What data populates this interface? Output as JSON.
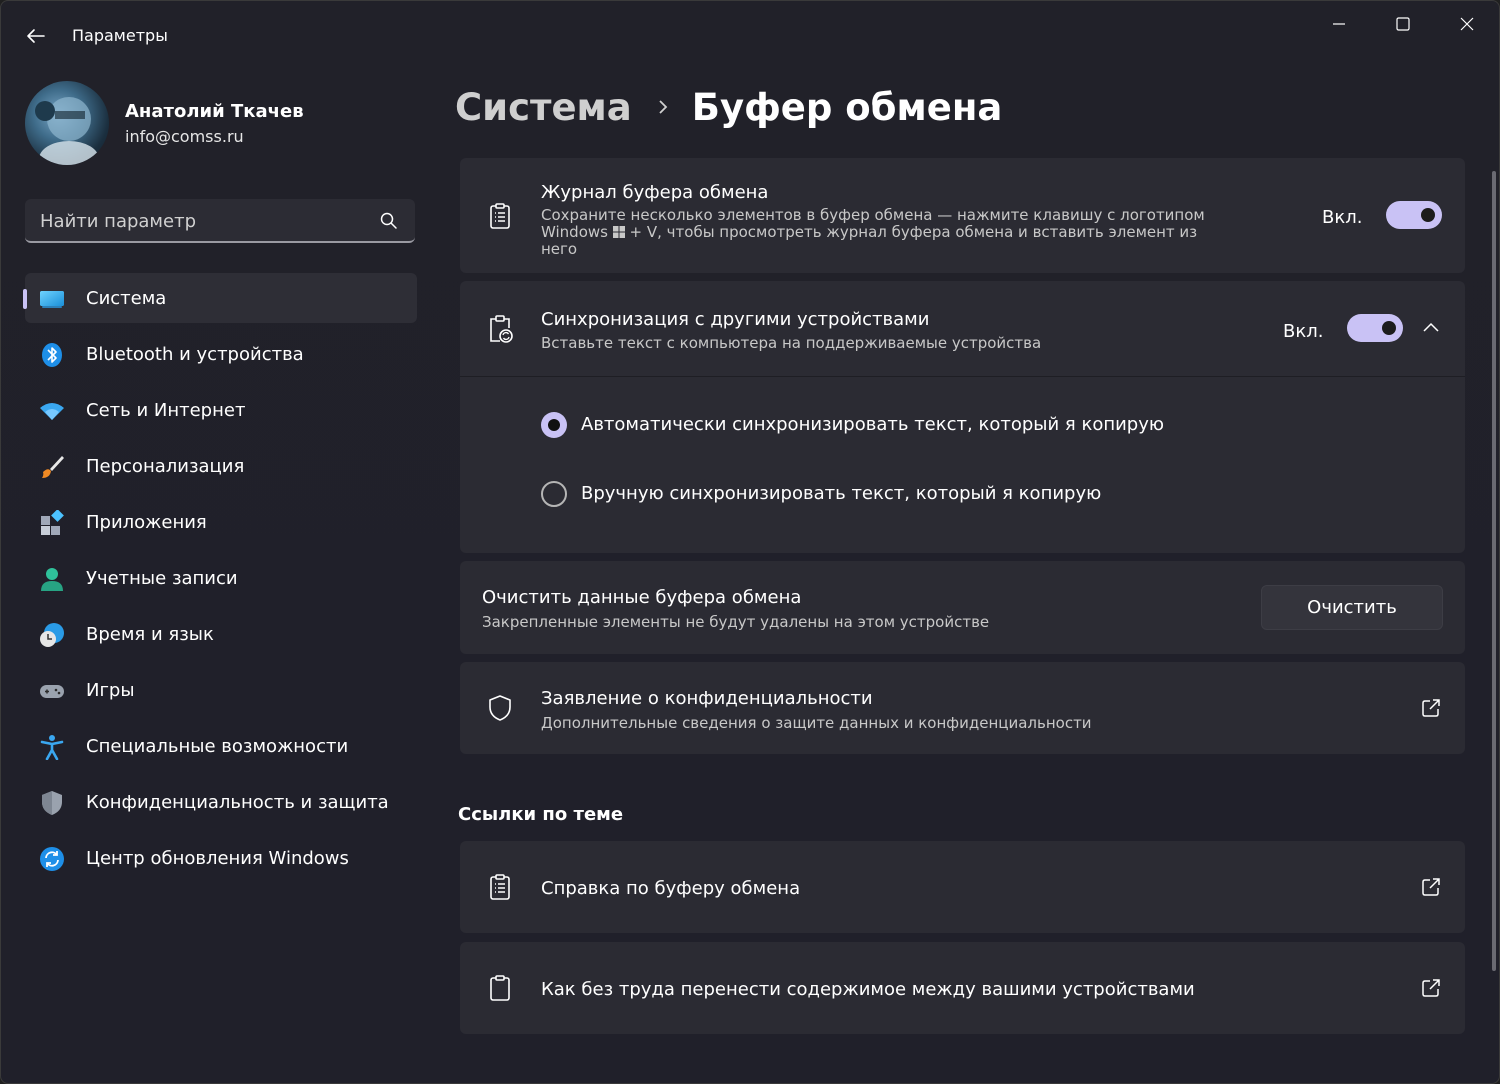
{
  "window": {
    "title": "Параметры"
  },
  "user": {
    "name": "Анатолий Ткачев",
    "email": "info@comss.ru"
  },
  "search": {
    "placeholder": "Найти параметр"
  },
  "nav": {
    "items": [
      {
        "label": "Система",
        "icon": "system-icon",
        "active": true
      },
      {
        "label": "Bluetooth и устройства",
        "icon": "bluetooth-icon"
      },
      {
        "label": "Сеть и Интернет",
        "icon": "wifi-icon"
      },
      {
        "label": "Персонализация",
        "icon": "brush-icon"
      },
      {
        "label": "Приложения",
        "icon": "apps-icon"
      },
      {
        "label": "Учетные записи",
        "icon": "account-icon"
      },
      {
        "label": "Время и язык",
        "icon": "clock-globe-icon"
      },
      {
        "label": "Игры",
        "icon": "gamepad-icon"
      },
      {
        "label": "Специальные возможности",
        "icon": "accessibility-icon"
      },
      {
        "label": "Конфиденциальность и защита",
        "icon": "shield-icon"
      },
      {
        "label": "Центр обновления Windows",
        "icon": "update-icon"
      }
    ]
  },
  "breadcrumb": {
    "parent": "Система",
    "current": "Буфер обмена"
  },
  "history": {
    "title": "Журнал буфера обмена",
    "desc_line1": "Сохраните несколько элементов в буфер обмена — нажмите клавишу с логотипом",
    "desc_line2_pre": "Windows",
    "desc_line2_post": "+ V, чтобы просмотреть журнал буфера обмена и вставить элемент из",
    "desc_line3": "него",
    "toggle_label": "Вкл.",
    "toggle_on": true
  },
  "sync": {
    "title": "Синхронизация с другими устройствами",
    "desc": "Вставьте текст с компьютера на поддерживаемые устройства",
    "toggle_label": "Вкл.",
    "toggle_on": true,
    "options": [
      {
        "label": "Автоматически синхронизировать текст, который я копирую",
        "selected": true
      },
      {
        "label": "Вручную синхронизировать текст, который я копирую",
        "selected": false
      }
    ]
  },
  "clear": {
    "title": "Очистить данные буфера обмена",
    "desc": "Закрепленные элементы не будут удалены на этом устройстве",
    "button": "Очистить"
  },
  "privacy": {
    "title": "Заявление о конфиденциальности",
    "desc": "Дополнительные сведения о защите данных и конфиденциальности"
  },
  "related": {
    "title": "Ссылки по теме",
    "links": [
      {
        "label": "Справка по буферу обмена"
      },
      {
        "label": "Как без труда перенести содержимое между вашими устройствами"
      }
    ]
  },
  "colors": {
    "accent": "#c9c2f5",
    "card": "#2b2b33",
    "background": "#20202a"
  }
}
